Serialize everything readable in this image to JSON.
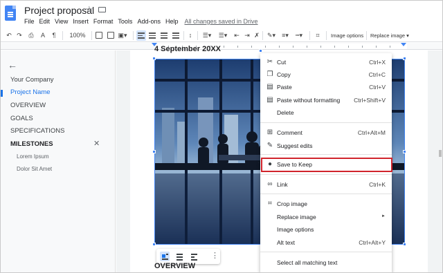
{
  "header": {
    "title": "Project proposal",
    "menus": [
      "File",
      "Edit",
      "View",
      "Insert",
      "Format",
      "Tools",
      "Add-ons",
      "Help"
    ],
    "saved_status": "All changes saved in Drive"
  },
  "toolbar": {
    "zoom": "100%",
    "image_options_label": "Image options",
    "replace_image_label": "Replace image ▾"
  },
  "sidebar": {
    "items": [
      {
        "label": "Your Company"
      },
      {
        "label": "Project Name"
      },
      {
        "label": "OVERVIEW"
      },
      {
        "label": "GOALS"
      },
      {
        "label": "SPECIFICATIONS"
      },
      {
        "label": "MILESTONES"
      },
      {
        "label": "Lorem Ipsum"
      },
      {
        "label": "Dolor Sit Amet"
      }
    ]
  },
  "document": {
    "heading_top": "4  September 20XX",
    "heading_bottom": "OVERVIEW"
  },
  "context_menu": {
    "items": [
      {
        "label": "Cut",
        "shortcut": "Ctrl+X",
        "icon": "scissors-icon"
      },
      {
        "label": "Copy",
        "shortcut": "Ctrl+C",
        "icon": "copy-icon"
      },
      {
        "label": "Paste",
        "shortcut": "Ctrl+V",
        "icon": "paste-icon"
      },
      {
        "label": "Paste without formatting",
        "shortcut": "Ctrl+Shift+V",
        "icon": "paste-plain-icon"
      },
      {
        "label": "Delete",
        "shortcut": "",
        "icon": ""
      },
      {
        "label": "Comment",
        "shortcut": "Ctrl+Alt+M",
        "icon": "add-comment-icon"
      },
      {
        "label": "Suggest edits",
        "shortcut": "",
        "icon": "suggest-edits-icon"
      },
      {
        "label": "Save to Keep",
        "shortcut": "",
        "icon": "lightbulb-icon"
      },
      {
        "label": "Link",
        "shortcut": "Ctrl+K",
        "icon": "link-icon"
      },
      {
        "label": "Crop image",
        "shortcut": "",
        "icon": "crop-icon"
      },
      {
        "label": "Replace image",
        "shortcut": "►",
        "icon": ""
      },
      {
        "label": "Image options",
        "shortcut": "",
        "icon": ""
      },
      {
        "label": "Alt text",
        "shortcut": "Ctrl+Alt+Y",
        "icon": ""
      },
      {
        "label": "Select all matching text",
        "shortcut": "",
        "icon": ""
      }
    ]
  },
  "colors": {
    "accent": "#1a73e8",
    "highlight": "#d0232b",
    "docs_blue": "#4285f4"
  }
}
